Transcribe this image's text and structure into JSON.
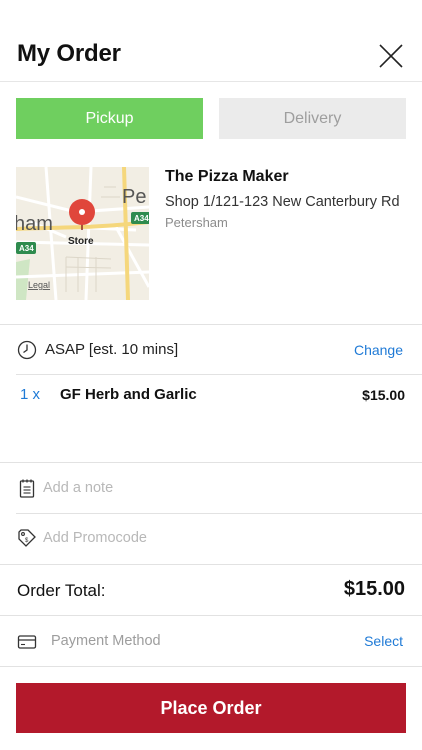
{
  "header": {
    "title": "My Order"
  },
  "order_type": {
    "pickup_label": "Pickup",
    "delivery_label": "Delivery"
  },
  "map": {
    "store_label": "Store",
    "legal_label": "Legal",
    "place_text_1": "Pe",
    "place_text_2": "ham",
    "road_badge": "A34"
  },
  "store": {
    "name": "The Pizza Maker",
    "address": "Shop 1/121-123 New Canterbury Rd",
    "suburb": "Petersham"
  },
  "time": {
    "label": "ASAP [est. 10 mins]",
    "change_label": "Change"
  },
  "items": [
    {
      "qty": "1 x",
      "name": "GF Herb and Garlic",
      "price": "$15.00"
    }
  ],
  "note": {
    "placeholder": "Add a note"
  },
  "promo": {
    "placeholder": "Add Promocode"
  },
  "total": {
    "label": "Order Total:",
    "value": "$15.00"
  },
  "payment": {
    "label": "Payment Method",
    "select_label": "Select"
  },
  "place_order": {
    "label": "Place Order"
  },
  "colors": {
    "accent_green": "#6fcf5f",
    "link_blue": "#1f7ad6",
    "place_red": "#b3192b",
    "pin_red": "#e0463b"
  }
}
